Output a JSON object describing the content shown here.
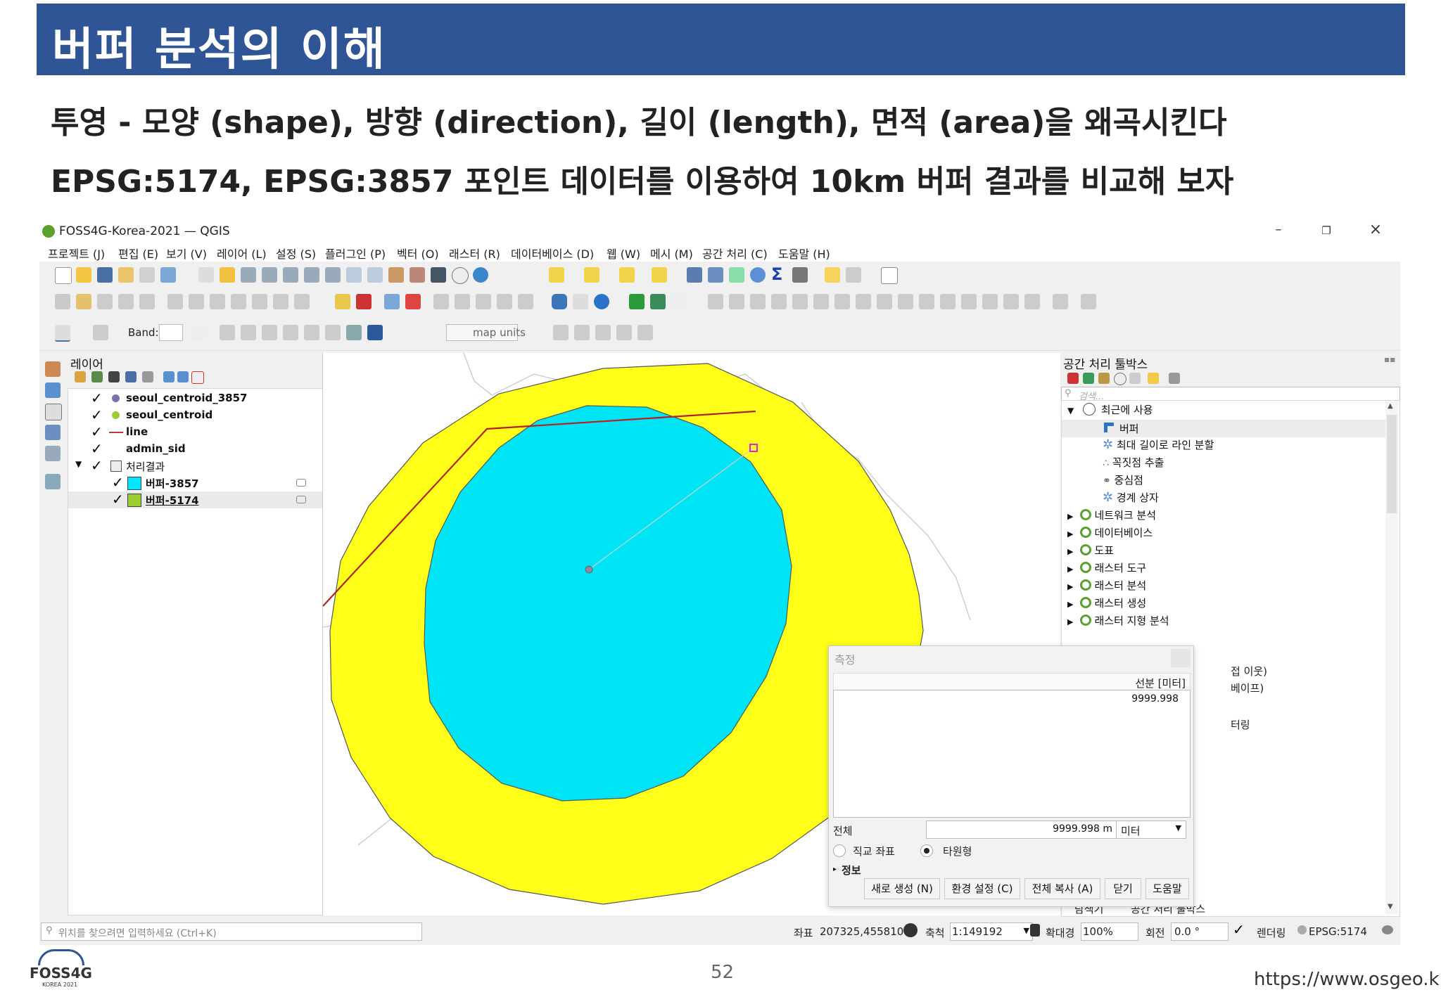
{
  "slide": {
    "title": "버퍼 분석의 이해",
    "line1": "투영 - 모양 (shape), 방향 (direction), 길이 (length), 면적 (area)을 왜곡시킨다",
    "line2": "EPSG:5174, EPSG:3857 포인트 데이터를 이용하여 10km 버퍼 결과를 비교해 보자",
    "page_number": "52",
    "url": "https://www.osgeo.kr",
    "logo_text": "FOSS4G",
    "logo_sub": "KOREA 2021"
  },
  "window": {
    "title": "FOSS4G-Korea-2021 — QGIS",
    "minimize": "–",
    "restore": "❐",
    "close": "×"
  },
  "menu": [
    "프로젝트 (J)",
    "편집 (E)",
    "보기 (V)",
    "레이어 (L)",
    "설정 (S)",
    "플러그인 (P)",
    "벡터 (O)",
    "래스터 (R)",
    "데이터베이스 (D)",
    "웹 (W)",
    "메시 (M)",
    "공간 처리 (C)",
    "도움말 (H)"
  ],
  "toolbar3": {
    "band_label": "Band:",
    "units": "map units"
  },
  "layers": {
    "title": "레이어",
    "items": [
      {
        "name": "seoul_centroid_3857",
        "symbol": "#7b6fa8"
      },
      {
        "name": "seoul_centroid",
        "symbol": "#9acd32"
      },
      {
        "name": "line",
        "symbol": "#c0392b"
      },
      {
        "name": "admin_sid",
        "symbol": "#ffffff"
      },
      {
        "name": "처리결과",
        "symbol": "group"
      },
      {
        "name": "버퍼-3857",
        "symbol": "#00e5ff"
      },
      {
        "name": "버퍼-5174",
        "symbol": "#9acd32"
      }
    ]
  },
  "map": {
    "outer_buffer_color": "#ffff1a",
    "inner_buffer_color": "#00e5f5",
    "line_color": "#b22222"
  },
  "toolbox": {
    "title": "공간 처리 툴박스",
    "search_placeholder": "검색...",
    "recent": "최근에 사용",
    "recent_items": [
      "버퍼",
      "최대 길이로 라인 분할",
      "꼭짓점 추출",
      "중심점",
      "경계 상자"
    ],
    "groups": [
      "네트워크 분석",
      "데이터베이스",
      "도표",
      "래스터 도구",
      "래스터 분석",
      "래스터 생성",
      "래스터 지형 분석"
    ],
    "behind_text": [
      "접 이웃)",
      "베이프)",
      "터링"
    ],
    "tabs": [
      "탐색기",
      "공간 처리 툴박스"
    ]
  },
  "measure": {
    "title": "측정",
    "column": "선분 [미터]",
    "segment_value": "9999.998",
    "total_label": "전체",
    "total_value": "9999.998 m",
    "unit": "미터",
    "opt_cartesian": "직교 좌표",
    "opt_ellipsoidal": "타원형",
    "info": "정보",
    "buttons": [
      "새로 생성 (N)",
      "환경 설정 (C)",
      "전체 복사 (A)",
      "닫기",
      "도움말"
    ]
  },
  "status": {
    "locator_placeholder": "위치를 찾으려면 입력하세요 (Ctrl+K)",
    "coord_label": "좌표",
    "coord_value": "207325,455810",
    "scale_label": "축척",
    "scale_value": "1:149192",
    "magnifier_label": "확대경",
    "magnifier_value": "100%",
    "rotation_label": "회전",
    "rotation_value": "0.0 °",
    "render_label": "렌더링",
    "crs": "EPSG:5174"
  }
}
